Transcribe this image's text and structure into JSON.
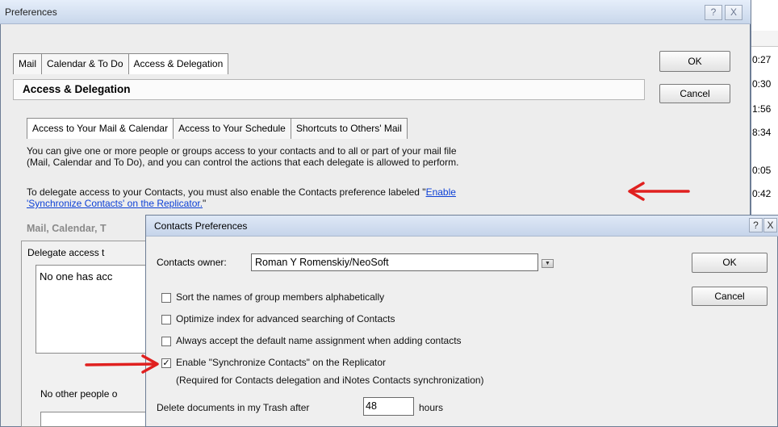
{
  "preferences": {
    "title": "Preferences",
    "help_glyph": "?",
    "close_glyph": "X",
    "tabs": [
      "Mail",
      "Calendar & To Do",
      "Access & Delegation"
    ],
    "ok_label": "OK",
    "cancel_label": "Cancel",
    "section_header": "Access & Delegation",
    "sub_tabs": [
      "Access to Your Mail & Calendar",
      "Access to Your Schedule",
      "Shortcuts to Others' Mail"
    ],
    "description_line1": "You can give one or more people or groups access to your contacts and to all or part of your mail file",
    "description_line2": "(Mail, Calendar and To Do), and you can control the actions that each delegate is allowed to perform.",
    "delegate_note_line1_prefix": "To delegate access to your Contacts, you must also enable the Contacts preference labeled \"",
    "delegate_note_link_part1": "Enable",
    "delegate_note_link_part2": "'Synchronize Contacts' on the Replicator.",
    "delegate_note_suffix": "\"",
    "mail_calendar_label": "Mail, Calendar, T",
    "delegate_access_label": "Delegate access t",
    "delegate_list_text": "No one has acc",
    "no_other_label": "No other people o"
  },
  "background_times": [
    "0:27",
    "0:30",
    "1:56",
    "8:34",
    "0:05",
    "0:42"
  ],
  "contacts_dialog": {
    "title": "Contacts Preferences",
    "help_glyph": "?",
    "close_glyph": "X",
    "owner_label": "Contacts owner:",
    "owner_value": "Roman Y Romenskiy/NeoSoft",
    "dropdown_glyph": "▼",
    "ok_label": "OK",
    "cancel_label": "Cancel",
    "options": [
      {
        "label": "Sort the names of group members alphabetically",
        "checked": false
      },
      {
        "label": "Optimize index for advanced searching of Contacts",
        "checked": false
      },
      {
        "label": "Always accept the default name assignment when adding contacts",
        "checked": false
      },
      {
        "label": "Enable \"Synchronize Contacts\" on the Replicator",
        "checked": true
      }
    ],
    "option_note": "(Required for Contacts delegation and iNotes Contacts synchronization)",
    "trash_label_before": "Delete documents in my Trash after",
    "trash_value": "48",
    "trash_label_after": "hours"
  },
  "colors": {
    "annotation_arrow": "#e0201f",
    "link": "#0b3fd6"
  }
}
